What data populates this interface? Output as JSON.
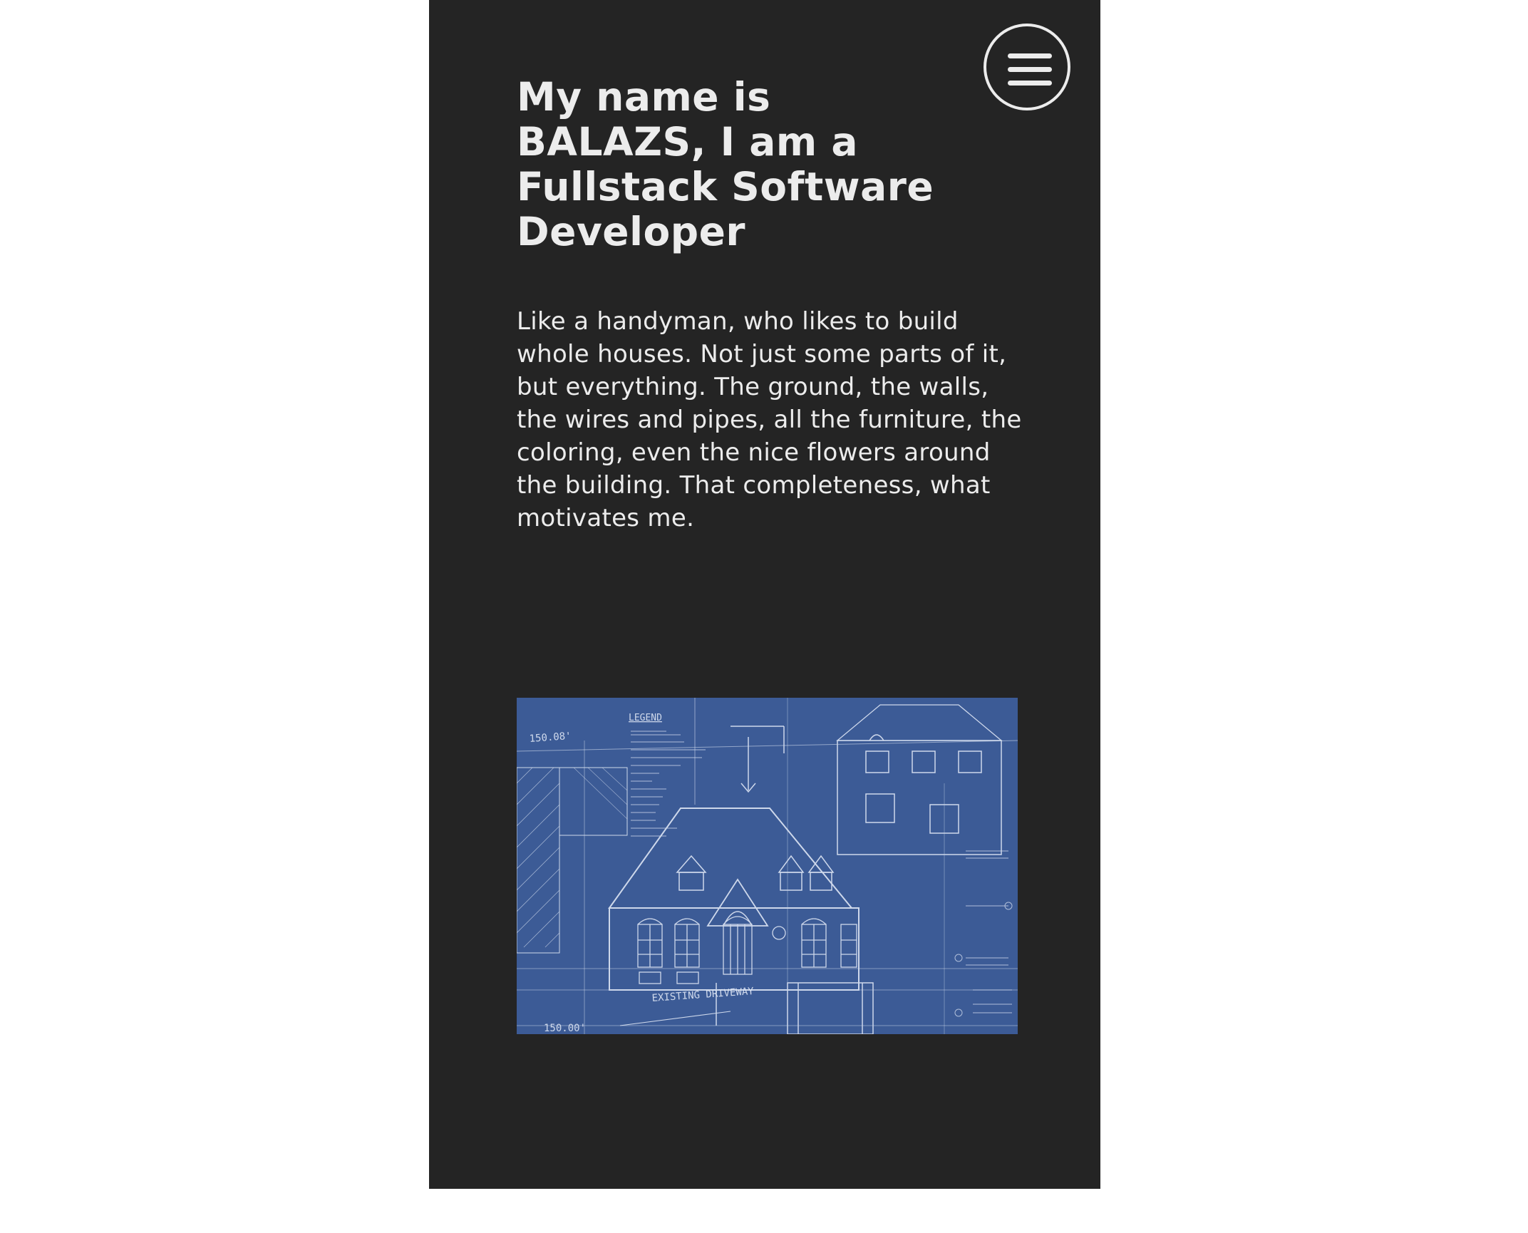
{
  "header": {
    "menu_icon": "hamburger-menu-icon",
    "title": "My name is BALAZS, I am a Fullstack Software Developer"
  },
  "main": {
    "intro": "Like a handyman, who likes to build whole houses. Not just some parts of it, but everything. The ground, the walls, the wires and pipes, all the furniture, the coloring, even the nice flowers around the building. That completeness, what motivates me.",
    "image": {
      "description": "blueprint drawing of a house",
      "legend_label": "LEGEND",
      "driveway_label": "EXISTING DRIVEWAY",
      "dimension_top": "150.08'",
      "dimension_bottom": "150.00'"
    }
  },
  "colors": {
    "page_background": "#ffffff",
    "panel_background": "#242424",
    "text": "#ececec",
    "blueprint_background": "#3c5b96",
    "blueprint_lines": "#dfe7f5"
  }
}
